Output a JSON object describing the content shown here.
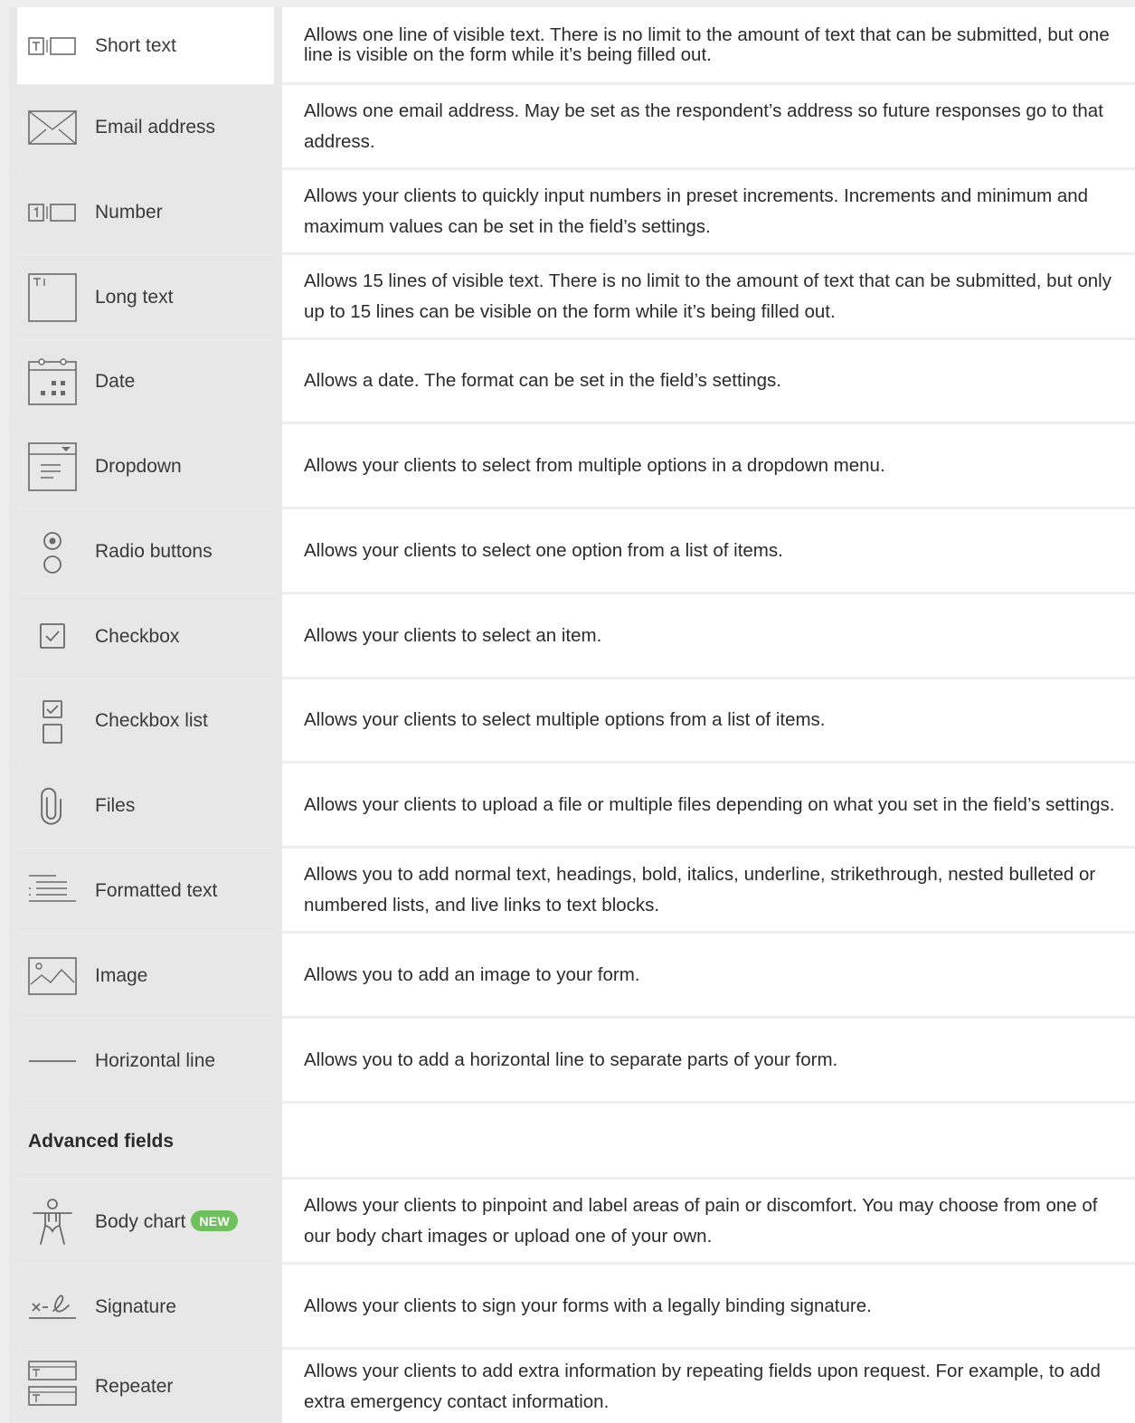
{
  "fields": [
    {
      "name": "short-text",
      "icon": "short-text-icon",
      "label": "Short text",
      "desc": "Allows one line of visible text. There is no limit to the amount of text that can be submitted, but one line is visible on the form while it’s being filled out."
    },
    {
      "name": "email-address",
      "icon": "envelope-icon",
      "label": "Email address",
      "desc": "Allows one email address. May be set as the respondent’s address so future responses go to that address."
    },
    {
      "name": "number",
      "icon": "number-icon",
      "label": "Number",
      "desc": "Allows your clients to quickly input numbers in preset increments. Increments and minimum and maximum values can be set in the field’s settings."
    },
    {
      "name": "long-text",
      "icon": "long-text-icon",
      "label": "Long text",
      "desc": "Allows 15 lines of visible text. There is no limit to the amount of text that can be submitted, but only up to 15 lines can be visible on the form while it’s being filled out."
    },
    {
      "name": "date",
      "icon": "calendar-icon",
      "label": "Date",
      "desc": "Allows a date. The format can be set in the field’s settings."
    },
    {
      "name": "dropdown",
      "icon": "dropdown-icon",
      "label": "Dropdown",
      "desc": "Allows your clients to select from multiple options in a dropdown menu."
    },
    {
      "name": "radio-buttons",
      "icon": "radio-icon",
      "label": "Radio buttons",
      "desc": "Allows your clients to select one option from a list of items."
    },
    {
      "name": "checkbox",
      "icon": "checkbox-icon",
      "label": "Checkbox",
      "desc": "Allows your clients to select an item."
    },
    {
      "name": "checkbox-list",
      "icon": "checkbox-list-icon",
      "label": "Checkbox list",
      "desc": "Allows your clients to select multiple options from a list of items."
    },
    {
      "name": "files",
      "icon": "paperclip-icon",
      "label": "Files",
      "desc": "Allows your clients to upload a file or multiple files depending on what you set in the field’s settings."
    },
    {
      "name": "formatted-text",
      "icon": "formatted-text-icon",
      "label": "Formatted text",
      "desc": "Allows you to add normal text, headings, bold, italics, underline, strikethrough, nested bulleted or numbered lists, and live links to text blocks."
    },
    {
      "name": "image",
      "icon": "image-icon",
      "label": "Image",
      "desc": "Allows you to add an image to your form."
    },
    {
      "name": "horizontal-line",
      "icon": "horizontal-line-icon",
      "label": "Horizontal line",
      "desc": "Allows you to add a horizontal line to separate parts of your form."
    }
  ],
  "advanced_heading": "Advanced fields",
  "advanced": [
    {
      "name": "body-chart",
      "icon": "body-chart-icon",
      "label": "Body chart",
      "badge": "NEW",
      "desc": "Allows your clients to pinpoint and label areas of pain or discomfort. You may choose from one of our body chart images or upload one of your own."
    },
    {
      "name": "signature",
      "icon": "signature-icon",
      "label": "Signature",
      "desc": "Allows your clients to sign your forms with a legally binding signature."
    },
    {
      "name": "repeater",
      "icon": "repeater-icon",
      "label": "Repeater",
      "desc": "Allows your clients to add extra information by repeating fields upon request. For example, to add extra emergency contact information."
    }
  ],
  "colors": {
    "badge": "#6dc05b",
    "icon_stroke": "#6a6a6a"
  }
}
